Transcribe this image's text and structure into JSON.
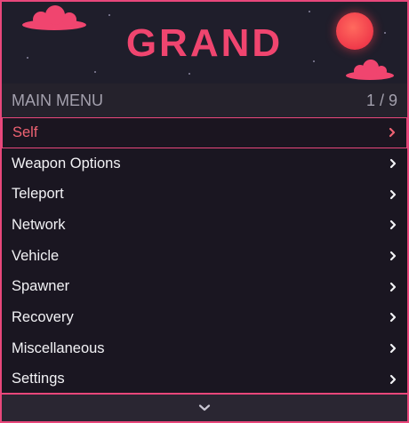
{
  "banner": {
    "title": "GRAND",
    "icons": [
      "cloud-icon",
      "sun-icon",
      "cloud-icon"
    ]
  },
  "header": {
    "title": "MAIN MENU",
    "page_indicator": "1 / 9"
  },
  "items": [
    {
      "label": "Self",
      "selected": true,
      "icon": "chevron-right-icon"
    },
    {
      "label": "Weapon Options",
      "selected": false,
      "icon": "chevron-right-icon"
    },
    {
      "label": "Teleport",
      "selected": false,
      "icon": "chevron-right-icon"
    },
    {
      "label": "Network",
      "selected": false,
      "icon": "chevron-right-icon"
    },
    {
      "label": "Vehicle",
      "selected": false,
      "icon": "chevron-right-icon"
    },
    {
      "label": "Spawner",
      "selected": false,
      "icon": "chevron-right-icon"
    },
    {
      "label": "Recovery",
      "selected": false,
      "icon": "chevron-right-icon"
    },
    {
      "label": "Miscellaneous",
      "selected": false,
      "icon": "chevron-right-icon"
    },
    {
      "label": "Settings",
      "selected": false,
      "icon": "chevron-right-icon"
    }
  ],
  "footer": {
    "icon": "chevron-down-icon"
  },
  "colors": {
    "accent": "#e8477b",
    "selected_text": "#ef6373",
    "banner_title": "#f0456f",
    "item_text": "#f2f2f5",
    "background": "#1a1621"
  }
}
